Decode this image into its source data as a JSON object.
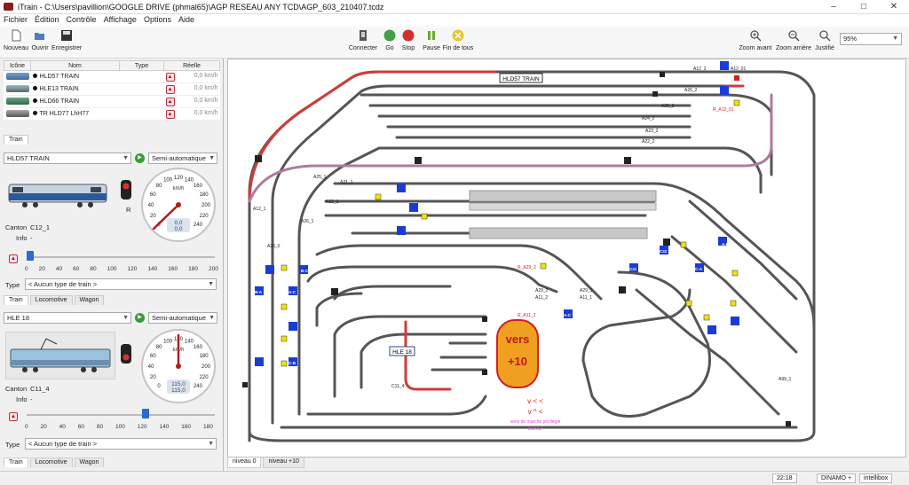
{
  "window": {
    "title": "iTrain - C:\\Users\\pavillion\\GOOGLE DRIVE (phmal65)\\AGP RESEAU ANY TCD\\AGP_603_210407.tcdz"
  },
  "menu": [
    "Fichier",
    "Édition",
    "Contrôle",
    "Affichage",
    "Options",
    "Aide"
  ],
  "toolbar": {
    "nouveau": "Nouveau",
    "ouvrir": "Ouvrir",
    "enregistrer": "Enregistrer",
    "connecter": "Connecter",
    "go": "Go",
    "stop": "Stop",
    "pause": "Pause",
    "fin": "Fin de tous",
    "zoom_avant": "Zoom avant",
    "zoom_arriere": "Zoom arrière",
    "justifie": "Justifié",
    "zoom_value": "95%"
  },
  "train_table": {
    "headers": [
      "Icône",
      "Nom",
      "Type",
      "Réelle"
    ],
    "rows": [
      {
        "name": "HLD57 TRAIN",
        "speed": "0,0 km/h"
      },
      {
        "name": "HLE13 TRAIN",
        "speed": "0,0 km/h"
      },
      {
        "name": "HLD66 TRAIN",
        "speed": "0,0 km/h"
      },
      {
        "name": "TR  HLD77 LhH77",
        "speed": "0,0 km/h"
      }
    ]
  },
  "panel1": {
    "tab": "Train",
    "train": "HLD57 TRAIN",
    "mode": "Semi-automatique",
    "canton_label": "Canton",
    "canton": "C12_1",
    "info_label": "Info",
    "info_value": "-",
    "signal_letter": "R",
    "gauge_unit": "km/h",
    "speed_a": "0,0",
    "speed_b": "0,0",
    "slider_value": 0,
    "slider_ticks": [
      "0",
      "20",
      "40",
      "60",
      "80",
      "100",
      "120",
      "140",
      "160",
      "180",
      "200"
    ],
    "type_label": "Type",
    "type_value": "< Aucun type de train >",
    "tabs": [
      "Train",
      "Locomotive",
      "Wagon"
    ]
  },
  "panel2": {
    "train": "HLE 18",
    "mode": "Semi-automatique",
    "canton_label": "Canton",
    "canton": "C11_4",
    "info_label": "Info",
    "info_value": "-",
    "gauge_unit": "km/h",
    "speed_a": "115,0",
    "speed_b": "115,0",
    "slider_value": 115,
    "slider_ticks": [
      "0",
      "20",
      "40",
      "60",
      "80",
      "100",
      "120",
      "140",
      "160",
      "180"
    ],
    "type_label": "Type",
    "type_value": "< Aucun type de train >",
    "tabs": [
      "Train",
      "Locomotive",
      "Wagon"
    ]
  },
  "gauge_ticks": [
    "0",
    "20",
    "40",
    "60",
    "80",
    "100",
    "120",
    "140",
    "160",
    "180",
    "200",
    "220",
    "240"
  ],
  "layout": {
    "train_label_1": "HLD57 TRAIN",
    "train_label_2": "HLE 18",
    "vers_line1": "vers",
    "vers_line2": "+10",
    "note_line1": "sens de marche privilégié",
    "note_line2": "inversé",
    "labels": [
      "A12_2",
      "A12_01",
      "A26_2",
      "R_A12_01",
      "A25_2",
      "A24_2",
      "A23_2",
      "A22_2",
      "A21_1",
      "A25_1",
      "A23_1",
      "A12_1",
      "A26_1",
      "A26_0",
      "R_A29_2",
      "A29_2",
      "A11_2",
      "A29_1",
      "A11_1",
      "R_A11_2",
      "A99_1",
      "C11_4"
    ],
    "block_labels": [
      "A-B",
      "B-C",
      "A-C",
      "B-A",
      "C-B",
      "C32",
      "C31",
      "C-A",
      "A-C"
    ]
  },
  "bottom_tabs": [
    "niveau 0",
    "niveau +10"
  ],
  "status": {
    "time": "22:18",
    "dinamo": "DINAMO",
    "dinamo_mark": "+",
    "intellibox": "intellibox"
  }
}
